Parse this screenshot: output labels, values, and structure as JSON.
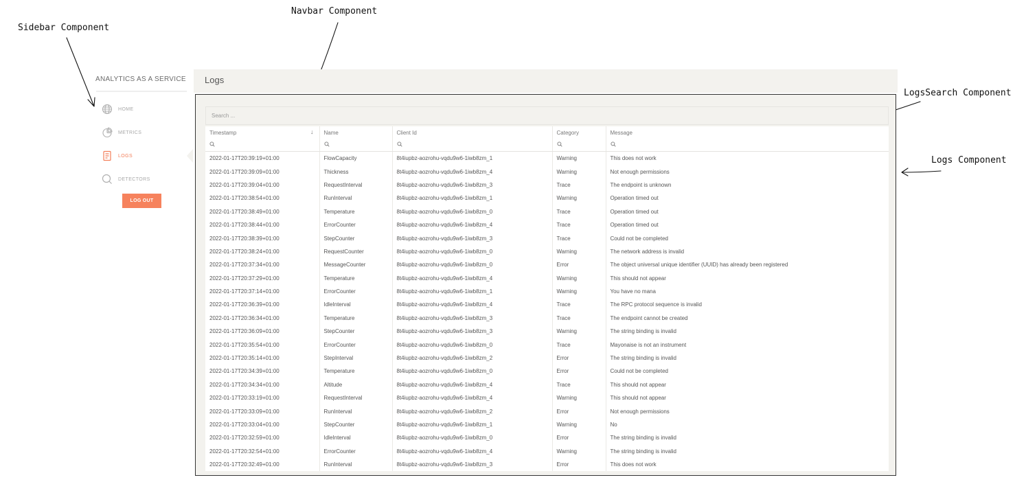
{
  "annotations": {
    "sidebar": "Sidebar Component",
    "navbar": "Navbar Component",
    "logs_search": "LogsSearch Component",
    "logs": "Logs Component"
  },
  "sidebar": {
    "brand": "ANALYTICS AS A SERVICE",
    "items": [
      {
        "label": "HOME",
        "icon": "globe-icon"
      },
      {
        "label": "METRICS",
        "icon": "pie-chart-icon"
      },
      {
        "label": "LOGS",
        "icon": "document-icon"
      },
      {
        "label": "DETECTORS",
        "icon": "search-icon"
      }
    ],
    "active": "LOGS",
    "logout": "LOG OUT"
  },
  "navbar": {
    "title": "Logs"
  },
  "search": {
    "placeholder": "Search ..."
  },
  "colors": {
    "accent": "#f6825d",
    "panel": "#f3f2ee"
  },
  "table": {
    "columns": [
      "Timestamp",
      "Name",
      "Client Id",
      "Category",
      "Message"
    ],
    "sort_indicator": "↓",
    "rows": [
      [
        "2022-01-17T20:39:19+01:00",
        "FlowCapacity",
        "8t4iupbz-aozrohu-vqdu9w6-1iwb8zm_1",
        "Warning",
        "This does not work"
      ],
      [
        "2022-01-17T20:39:09+01:00",
        "Thickness",
        "8t4iupbz-aozrohu-vqdu9w6-1iwb8zm_4",
        "Warning",
        "Not enough permissions"
      ],
      [
        "2022-01-17T20:39:04+01:00",
        "RequestInterval",
        "8t4iupbz-aozrohu-vqdu9w6-1iwb8zm_3",
        "Trace",
        "The endpoint is unknown"
      ],
      [
        "2022-01-17T20:38:54+01:00",
        "RunInterval",
        "8t4iupbz-aozrohu-vqdu9w6-1iwb8zm_1",
        "Warning",
        "Operation timed out"
      ],
      [
        "2022-01-17T20:38:49+01:00",
        "Temperature",
        "8t4iupbz-aozrohu-vqdu9w6-1iwb8zm_0",
        "Trace",
        "Operation timed out"
      ],
      [
        "2022-01-17T20:38:44+01:00",
        "ErrorCounter",
        "8t4iupbz-aozrohu-vqdu9w6-1iwb8zm_4",
        "Trace",
        "Operation timed out"
      ],
      [
        "2022-01-17T20:38:39+01:00",
        "StepCounter",
        "8t4iupbz-aozrohu-vqdu9w6-1iwb8zm_3",
        "Trace",
        "Could not be completed"
      ],
      [
        "2022-01-17T20:38:24+01:00",
        "RequestCounter",
        "8t4iupbz-aozrohu-vqdu9w6-1iwb8zm_0",
        "Warning",
        "The network address is invalid"
      ],
      [
        "2022-01-17T20:37:34+01:00",
        "MessageCounter",
        "8t4iupbz-aozrohu-vqdu9w6-1iwb8zm_0",
        "Error",
        "The object universal unique identifier (UUID) has already been registered"
      ],
      [
        "2022-01-17T20:37:29+01:00",
        "Temperature",
        "8t4iupbz-aozrohu-vqdu9w6-1iwb8zm_4",
        "Warning",
        "This should not appear"
      ],
      [
        "2022-01-17T20:37:14+01:00",
        "ErrorCounter",
        "8t4iupbz-aozrohu-vqdu9w6-1iwb8zm_1",
        "Warning",
        "You have no mana"
      ],
      [
        "2022-01-17T20:36:39+01:00",
        "IdleInterval",
        "8t4iupbz-aozrohu-vqdu9w6-1iwb8zm_4",
        "Trace",
        "The RPC protocol sequence is invalid"
      ],
      [
        "2022-01-17T20:36:34+01:00",
        "Temperature",
        "8t4iupbz-aozrohu-vqdu9w6-1iwb8zm_3",
        "Trace",
        "The endpoint cannot be created"
      ],
      [
        "2022-01-17T20:36:09+01:00",
        "StepCounter",
        "8t4iupbz-aozrohu-vqdu9w6-1iwb8zm_3",
        "Warning",
        "The string binding is invalid"
      ],
      [
        "2022-01-17T20:35:54+01:00",
        "ErrorCounter",
        "8t4iupbz-aozrohu-vqdu9w6-1iwb8zm_0",
        "Trace",
        "Mayonaise is not an instrument"
      ],
      [
        "2022-01-17T20:35:14+01:00",
        "StepInterval",
        "8t4iupbz-aozrohu-vqdu9w6-1iwb8zm_2",
        "Error",
        "The string binding is invalid"
      ],
      [
        "2022-01-17T20:34:39+01:00",
        "Temperature",
        "8t4iupbz-aozrohu-vqdu9w6-1iwb8zm_0",
        "Error",
        "Could not be completed"
      ],
      [
        "2022-01-17T20:34:34+01:00",
        "Altitude",
        "8t4iupbz-aozrohu-vqdu9w6-1iwb8zm_4",
        "Trace",
        "This should not appear"
      ],
      [
        "2022-01-17T20:33:19+01:00",
        "RequestInterval",
        "8t4iupbz-aozrohu-vqdu9w6-1iwb8zm_4",
        "Warning",
        "This should not appear"
      ],
      [
        "2022-01-17T20:33:09+01:00",
        "RunInterval",
        "8t4iupbz-aozrohu-vqdu9w6-1iwb8zm_2",
        "Error",
        "Not enough permissions"
      ],
      [
        "2022-01-17T20:33:04+01:00",
        "StepCounter",
        "8t4iupbz-aozrohu-vqdu9w6-1iwb8zm_1",
        "Warning",
        "No"
      ],
      [
        "2022-01-17T20:32:59+01:00",
        "IdleInterval",
        "8t4iupbz-aozrohu-vqdu9w6-1iwb8zm_0",
        "Error",
        "The string binding is invalid"
      ],
      [
        "2022-01-17T20:32:54+01:00",
        "ErrorCounter",
        "8t4iupbz-aozrohu-vqdu9w6-1iwb8zm_4",
        "Warning",
        "The string binding is invalid"
      ],
      [
        "2022-01-17T20:32:49+01:00",
        "RunInterval",
        "8t4iupbz-aozrohu-vqdu9w6-1iwb8zm_3",
        "Error",
        "This does not work"
      ]
    ]
  }
}
